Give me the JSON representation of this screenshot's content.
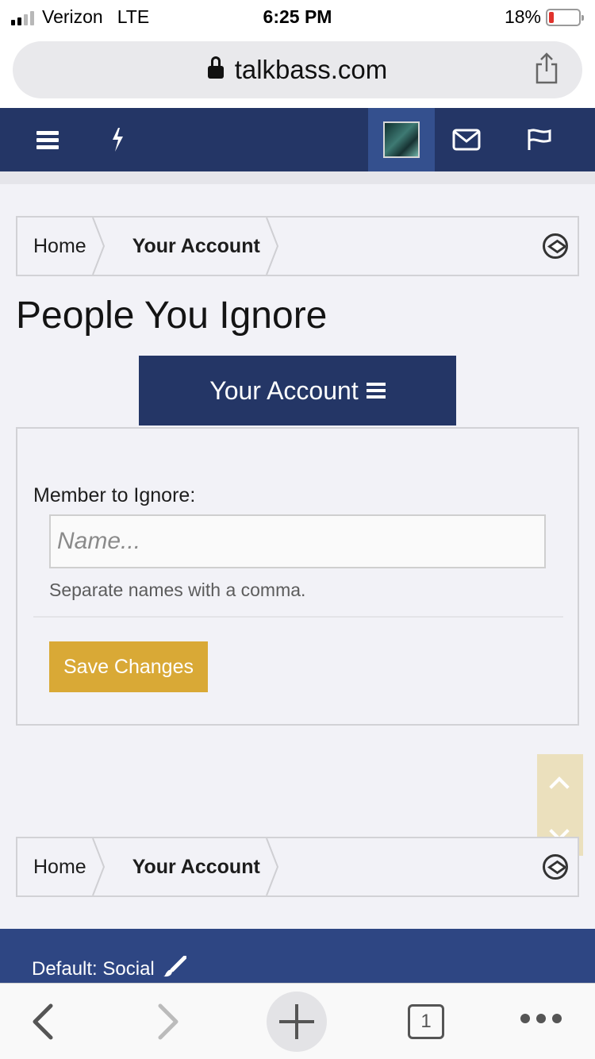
{
  "status_bar": {
    "carrier": "Verizon",
    "network": "LTE",
    "time": "6:25 PM",
    "battery": "18%",
    "battery_level": 0.18
  },
  "browser": {
    "url": "talkbass.com"
  },
  "breadcrumb": {
    "home": "Home",
    "account": "Your Account"
  },
  "page": {
    "title": "People You Ignore",
    "account_menu_label": "Your Account"
  },
  "form": {
    "label": "Member to Ignore:",
    "placeholder": "Name...",
    "value": "",
    "hint": "Separate names with a comma.",
    "save_label": "Save Changes"
  },
  "footer": {
    "style_label": "Default: Social"
  },
  "safari_toolbar": {
    "tab_count": "1"
  },
  "colors": {
    "nav": "#243666",
    "accent_button": "#d9a936",
    "footer": "#2e4683"
  },
  "icons": [
    "menu-icon",
    "bolt-icon",
    "avatar",
    "mail-icon",
    "flag-icon",
    "compass-icon",
    "paintbrush-icon",
    "back-icon",
    "forward-icon",
    "plus-icon",
    "tabs-icon",
    "more-icon"
  ]
}
